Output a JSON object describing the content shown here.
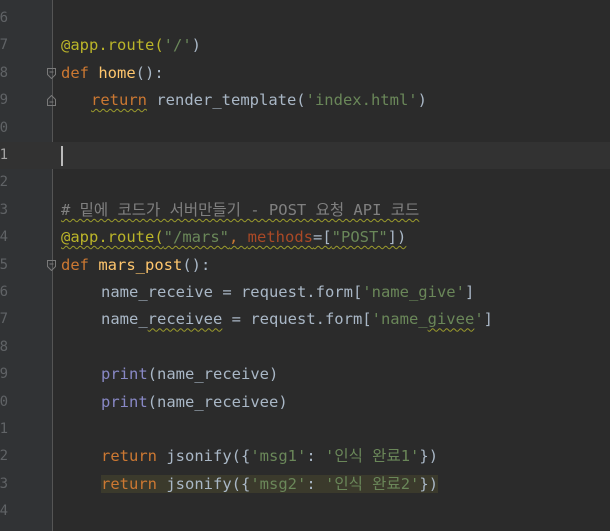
{
  "gutter": {
    "line_numbers": [
      "6",
      "7",
      "8",
      "9",
      "0",
      "1",
      "2",
      "3",
      "4",
      "5",
      "6",
      "7",
      "8",
      "9",
      "0",
      "1",
      "2",
      "3",
      "4"
    ]
  },
  "code": {
    "l7": {
      "decorator": "@app.route(",
      "arg": "'/'",
      "close": ")"
    },
    "l8": {
      "def": "def",
      "name": "home",
      "rest": "():"
    },
    "l9": {
      "ret": "return",
      "call": " render_template(",
      "arg": "'index.html'",
      "close": ")"
    },
    "l13": {
      "comment": "# 밑에 코드가 서버만들기 - POST 요청 API 코드"
    },
    "l14": {
      "decorator": "@app.route(",
      "arg": "\"/mars\"",
      "sep": ", ",
      "kw": "methods",
      "eq": "=[",
      "val": "\"POST\"",
      "close": "])"
    },
    "l15": {
      "def": "def",
      "name": "mars_post",
      "rest": "():"
    },
    "l16": {
      "lhs": "name_receive = request.form[",
      "key": "'name_give'",
      "close": "]"
    },
    "l17": {
      "lhs_a": "name_",
      "lhs_b": "receivee",
      "mid": " = request.form[",
      "key_a": "'name_",
      "key_b": "givee",
      "key_c": "'",
      "close": "]"
    },
    "l19": {
      "fn": "print",
      "args": "(name_receive)"
    },
    "l20": {
      "fn": "print",
      "args": "(name_receivee)"
    },
    "l22": {
      "ret": "return",
      "call": " jsonify({",
      "k": "'msg1'",
      "colon": ": ",
      "v": "'인식 완료1'",
      "close": "})"
    },
    "l23": {
      "ret": "return",
      "call": " jsonify({",
      "k": "'msg2'",
      "colon": ": ",
      "v": "'인식 완료2'",
      "close": "})"
    }
  },
  "colors": {
    "background": "#2b2b2b",
    "keyword": "#cc7832",
    "decorator": "#bbb529",
    "function": "#ffc66d",
    "string": "#6a8759",
    "comment": "#808080",
    "builtin": "#8888c6",
    "kwarg": "#aa4926",
    "text": "#a9b7c6"
  }
}
